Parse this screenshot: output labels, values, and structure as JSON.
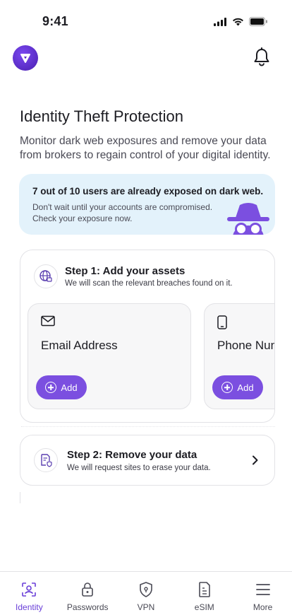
{
  "status_bar": {
    "time": "9:41"
  },
  "header": {
    "logo_icon": "shield-logo-icon",
    "bell_icon": "bell-icon"
  },
  "page": {
    "title": "Identity Theft Protection",
    "subtitle": "Monitor dark web exposures and remove your data from brokers to regain control of your digital identity."
  },
  "alert": {
    "title": "7 out of 10 users are already exposed on dark web.",
    "text": "Don't wait until your accounts are compromised. Check your exposure now."
  },
  "step1": {
    "title": "Step 1: Add your assets",
    "description": "We will scan the relevant breaches found on it.",
    "assets": [
      {
        "label": "Email Address",
        "icon": "envelope-icon",
        "button": "Add"
      },
      {
        "label": "Phone Number",
        "icon": "phone-icon",
        "button": "Add"
      }
    ]
  },
  "step2": {
    "title": "Step 2: Remove your data",
    "description": "We will request sites to erase your data."
  },
  "nav": {
    "items": [
      {
        "label": "Identity",
        "icon": "identity-icon",
        "active": true
      },
      {
        "label": "Passwords",
        "icon": "lock-icon",
        "active": false
      },
      {
        "label": "VPN",
        "icon": "shield-lock-icon",
        "active": false
      },
      {
        "label": "eSIM",
        "icon": "sim-card-icon",
        "active": false
      },
      {
        "label": "More",
        "icon": "menu-icon",
        "active": false
      }
    ]
  },
  "colors": {
    "accent": "#7b4fe0",
    "alert_bg": "#e3f2fb",
    "active_nav": "#6a3fd8"
  }
}
